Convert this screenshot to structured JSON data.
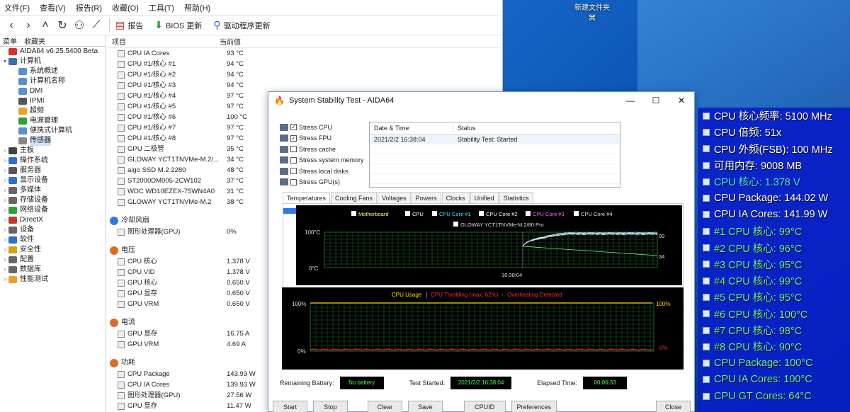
{
  "desktop": {
    "icon_label": "新建文件夹",
    "icon_sub": "⌘"
  },
  "main_window": {
    "menu": [
      "文件(F)",
      "查看(V)",
      "报告(R)",
      "收藏(O)",
      "工具(T)",
      "帮助(H)"
    ],
    "toolbar": {
      "report": "报告",
      "bios": "BIOS 更新",
      "driver": "驱动程序更新"
    },
    "left_tabs": [
      "菜单",
      "收藏夹"
    ],
    "tree": [
      {
        "label": "AIDA64 v6.25.5400 Beta",
        "level": 0,
        "color": "#d32f2f",
        "expand": ""
      },
      {
        "label": "计算机",
        "level": 0,
        "color": "#3a6ea5",
        "expand": "▾"
      },
      {
        "label": "系统概述",
        "level": 1,
        "color": "#5a8fd0",
        "expand": ""
      },
      {
        "label": "计算机名称",
        "level": 1,
        "color": "#5a8fd0",
        "expand": ""
      },
      {
        "label": "DMI",
        "level": 1,
        "color": "#5a8fd0",
        "expand": ""
      },
      {
        "label": "IPMI",
        "level": 1,
        "color": "#555555",
        "expand": ""
      },
      {
        "label": "超频",
        "level": 1,
        "color": "#f0a020",
        "expand": ""
      },
      {
        "label": "电源管理",
        "level": 1,
        "color": "#2e9e3f",
        "expand": ""
      },
      {
        "label": "便携式计算机",
        "level": 1,
        "color": "#5a8fd0",
        "expand": ""
      },
      {
        "label": "传感器",
        "level": 1,
        "color": "#888888",
        "expand": "",
        "selected": true
      },
      {
        "label": "主板",
        "level": 0,
        "color": "#444444",
        "expand": "›"
      },
      {
        "label": "操作系统",
        "level": 0,
        "color": "#2f6fd0",
        "expand": "›"
      },
      {
        "label": "服务器",
        "level": 0,
        "color": "#555555",
        "expand": "›"
      },
      {
        "label": "显示设备",
        "level": 0,
        "color": "#2f6fd0",
        "expand": "›"
      },
      {
        "label": "多媒体",
        "level": 0,
        "color": "#666666",
        "expand": "›"
      },
      {
        "label": "存储设备",
        "level": 0,
        "color": "#666666",
        "expand": "›"
      },
      {
        "label": "网络设备",
        "level": 0,
        "color": "#2e9e3f",
        "expand": "›"
      },
      {
        "label": "DirectX",
        "level": 0,
        "color": "#c0392b",
        "expand": "›"
      },
      {
        "label": "设备",
        "level": 0,
        "color": "#666666",
        "expand": "›"
      },
      {
        "label": "软件",
        "level": 0,
        "color": "#2f6fd0",
        "expand": "›"
      },
      {
        "label": "安全性",
        "level": 0,
        "color": "#d4a017",
        "expand": "›"
      },
      {
        "label": "配置",
        "level": 0,
        "color": "#666666",
        "expand": "›"
      },
      {
        "label": "数据库",
        "level": 0,
        "color": "#666666",
        "expand": "›"
      },
      {
        "label": "性能测试",
        "level": 0,
        "color": "#f0a020",
        "expand": "›"
      }
    ],
    "columns": [
      "项目",
      "当前值"
    ],
    "temperature_rows": [
      {
        "name": "CPU IA Cores",
        "value": "93 °C"
      },
      {
        "name": "CPU #1/核心 #1",
        "value": "94 °C"
      },
      {
        "name": "CPU #1/核心 #2",
        "value": "94 °C"
      },
      {
        "name": "CPU #1/核心 #3",
        "value": "94 °C"
      },
      {
        "name": "CPU #1/核心 #4",
        "value": "97 °C"
      },
      {
        "name": "CPU #1/核心 #5",
        "value": "97 °C"
      },
      {
        "name": "CPU #1/核心 #6",
        "value": "100 °C"
      },
      {
        "name": "CPU #1/核心 #7",
        "value": "97 °C"
      },
      {
        "name": "CPU #1/核心 #8",
        "value": "97 °C"
      },
      {
        "name": "GPU 二极管",
        "value": "35 °C"
      },
      {
        "name": "GLOWAY YCT1TNVMe-M.2/...",
        "value": "34 °C"
      },
      {
        "name": "aigo SSD M.2 2280",
        "value": "48 °C"
      },
      {
        "name": "ST2000DM005-2CW102",
        "value": "37 °C"
      },
      {
        "name": "WDC WD10EZEX-75WN4A0",
        "value": "31 °C"
      },
      {
        "name": "GLOWAY YCT1TNVMe-M.2",
        "value": "38 °C"
      }
    ],
    "fan_group": "冷却风扇",
    "fan_rows": [
      {
        "name": "图形处理器(GPU)",
        "value": "0%"
      }
    ],
    "voltage_group": "电压",
    "voltage_rows": [
      {
        "name": "CPU 核心",
        "value": "1.378 V"
      },
      {
        "name": "CPU VID",
        "value": "1.378 V"
      },
      {
        "name": "GPU 核心",
        "value": "0.650 V"
      },
      {
        "name": "GPU 显存",
        "value": "0.650 V"
      },
      {
        "name": "GPU VRM",
        "value": "0.650 V"
      }
    ],
    "current_group": "电流",
    "current_rows": [
      {
        "name": "GPU 显存",
        "value": "16.75 A"
      },
      {
        "name": "GPU VRM",
        "value": "4.69 A"
      }
    ],
    "power_group": "功耗",
    "power_rows": [
      {
        "name": "CPU Package",
        "value": "143.93 W"
      },
      {
        "name": "CPU IA Cores",
        "value": "139.93 W"
      },
      {
        "name": "图形处理器(GPU)",
        "value": "27.56 W"
      },
      {
        "name": "GPU 显存",
        "value": "11.47 W"
      }
    ]
  },
  "sst": {
    "title": "System Stability Test - AIDA64",
    "win_buttons": [
      "—",
      "☐",
      "✕"
    ],
    "stress_items": [
      {
        "label": "Stress CPU",
        "checked": true
      },
      {
        "label": "Stress FPU",
        "checked": true
      },
      {
        "label": "Stress cache",
        "checked": false
      },
      {
        "label": "Stress system memory",
        "checked": false
      },
      {
        "label": "Stress local disks",
        "checked": false
      },
      {
        "label": "Stress GPU(s)",
        "checked": false
      }
    ],
    "status_header": {
      "date": "Date & Time",
      "status": "Status"
    },
    "status_row": {
      "date": "2021/2/2 16:38:04",
      "status": "Stability Test: Started"
    },
    "tabs": [
      "Temperatures",
      "Cooling Fans",
      "Voltages",
      "Powers",
      "Clocks",
      "Unified",
      "Statistics"
    ],
    "temp_legend": [
      "Motherboard",
      "CPU",
      "CPU Core #1",
      "CPU Core #2",
      "CPU Core #3",
      "CPU Core #4"
    ],
    "temp_legend2": "GLOWAY YCT1TNVMe-M.2/80 Pro",
    "cpu_legend": [
      "CPU Usage",
      "CPU Throttling (max: 62%)",
      "Overheating Detected"
    ],
    "bottom": {
      "battery_label": "Remaining Battery:",
      "battery_value": "No battery",
      "started_label": "Test Started:",
      "started_value": "2021/2/2 16:38:04",
      "elapsed_label": "Elapsed Time:",
      "elapsed_value": "00:06:33"
    },
    "buttons": [
      "Start",
      "Stop",
      "Clear",
      "Save",
      "CPUID",
      "Preferences",
      "Close"
    ]
  },
  "osd": [
    {
      "text": "CPU 核心频率: 5100 MHz",
      "color": "white"
    },
    {
      "text": "CPU 倍频: 51x",
      "color": "white"
    },
    {
      "text": "CPU 外频(FSB): 100 MHz",
      "color": "white"
    },
    {
      "text": "可用内存: 9008 MB",
      "color": "white"
    },
    {
      "text": "CPU 核心: 1.378 V",
      "color": "cyan"
    },
    {
      "text": "CPU Package: 144.02 W",
      "color": "white"
    },
    {
      "text": "CPU IA Cores: 141.99 W",
      "color": "white"
    },
    {
      "text": "#1 CPU 核心: 99°C",
      "color": "green"
    },
    {
      "text": "#2 CPU 核心: 96°C",
      "color": "green"
    },
    {
      "text": "#3 CPU 核心: 95°C",
      "color": "green"
    },
    {
      "text": "#4 CPU 核心: 99°C",
      "color": "green"
    },
    {
      "text": "#5 CPU 核心: 95°C",
      "color": "green"
    },
    {
      "text": "#6 CPU 核心: 100°C",
      "color": "green"
    },
    {
      "text": "#7 CPU 核心: 98°C",
      "color": "green"
    },
    {
      "text": "#8 CPU 核心: 90°C",
      "color": "green"
    },
    {
      "text": "CPU Package: 100°C",
      "color": "green"
    },
    {
      "text": "CPU IA Cores: 100°C",
      "color": "green"
    },
    {
      "text": "CPU GT Cores: 64°C",
      "color": "green"
    }
  ],
  "chart_data": [
    {
      "type": "line",
      "title": "",
      "xlabel": "",
      "ylabel": "",
      "ylim": [
        0,
        100
      ],
      "ytick_labels": [
        "100°C",
        "0°C"
      ],
      "x_marker": "16:38:04",
      "series": [
        {
          "name": "CPU Core #1",
          "color": "#3cf0ff",
          "end_value": 99
        },
        {
          "name": "CPU Core #2",
          "color": "#ffffff",
          "end_value": 97
        },
        {
          "name": "CPU Core #3",
          "color": "#ff66ff",
          "end_value": 95
        },
        {
          "name": "CPU Core #4",
          "color": "#dddddd",
          "end_value": 94
        }
      ],
      "right_labels": [
        "99",
        "34"
      ],
      "grid": true
    },
    {
      "type": "line",
      "title": "",
      "ylim": [
        0,
        100
      ],
      "ytick_labels": [
        "100%",
        "0%"
      ],
      "right_labels": [
        "100%",
        "0%"
      ],
      "series": [
        {
          "name": "CPU Usage",
          "color": "#ffd700",
          "value": 100
        },
        {
          "name": "CPU Throttling (max: 62%)",
          "color": "#ff2a2a",
          "value": 2
        }
      ],
      "grid": true
    }
  ],
  "colors": {
    "osd_bg": "#081ec8",
    "chart_grid": "#1f6b2a",
    "chart_bg": "#000000"
  }
}
